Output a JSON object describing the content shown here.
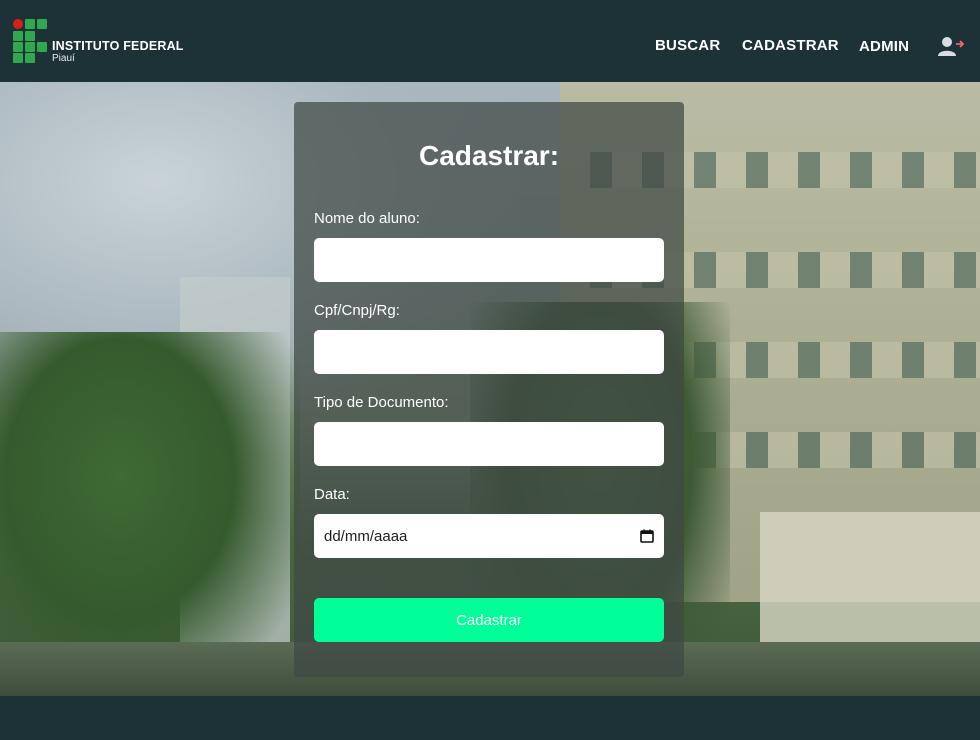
{
  "header": {
    "logo_title": "INSTITUTO FEDERAL",
    "logo_subtitle": "Piauí",
    "nav": {
      "buscar": "BUSCAR",
      "cadastrar": "CADASTRAR",
      "admin": "ADMIN"
    },
    "user_icon": "user-logout-icon"
  },
  "form": {
    "title": "Cadastrar:",
    "fields": [
      {
        "label": "Nome do aluno:",
        "value": ""
      },
      {
        "label": "Cpf/Cnpj/Rg:",
        "value": ""
      },
      {
        "label": "Tipo de Documento:",
        "value": ""
      },
      {
        "label": "Data:",
        "value": "dd/mm/aaaa"
      }
    ],
    "submit_label": "Cadastrar"
  },
  "colors": {
    "header_bg": "#1d3236",
    "panel_bg": "rgba(63,72,68,0.72)",
    "submit_bg": "#00ff99",
    "logo_green": "#2fa84f",
    "logo_red": "#d81e1e"
  }
}
